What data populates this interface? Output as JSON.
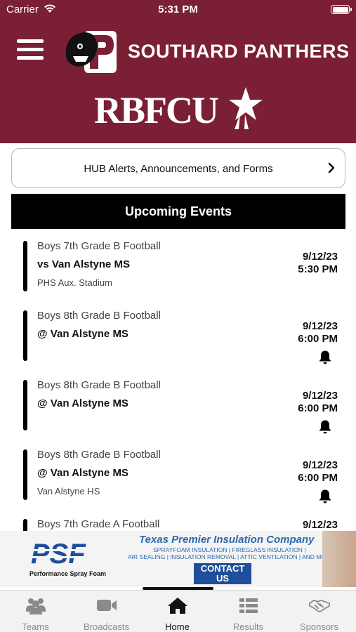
{
  "status_bar": {
    "carrier": "Carrier",
    "time": "5:31 PM"
  },
  "header": {
    "school_name": "SOUTHARD PANTHERS",
    "logo_letter": "P",
    "sponsor": "RBFCU",
    "bg_color": "#7a1f34"
  },
  "alerts": {
    "label": "HUB Alerts, Announcements, and Forms"
  },
  "events": {
    "header": "Upcoming Events",
    "items": [
      {
        "sport": "Boys 7th Grade B Football",
        "opponent": "vs Van Alstyne MS",
        "venue": "PHS Aux. Stadium",
        "date": "9/12/23",
        "time": "5:30 PM",
        "bell": false
      },
      {
        "sport": "Boys 8th Grade B Football",
        "opponent": "@ Van Alstyne MS",
        "venue": "",
        "date": "9/12/23",
        "time": "6:00 PM",
        "bell": true
      },
      {
        "sport": "Boys 8th Grade B Football",
        "opponent": "@ Van Alstyne MS",
        "venue": "",
        "date": "9/12/23",
        "time": "6:00 PM",
        "bell": true
      },
      {
        "sport": "Boys 8th Grade B Football",
        "opponent": "@ Van Alstyne MS",
        "venue": "Van Alstyne HS",
        "date": "9/12/23",
        "time": "6:00 PM",
        "bell": true
      },
      {
        "sport": "Boys 7th Grade A Football",
        "opponent": "",
        "venue": "",
        "date": "9/12/23",
        "time": "",
        "bell": false
      }
    ]
  },
  "ad": {
    "logo_text": "PSF",
    "logo_sub": "Performance Spray Foam",
    "company": "Texas Premier Insulation Company",
    "services_line1": "SPRAYFOAM INSULATION | FIREGLASS INSULATION |",
    "services_line2": "AIR SEALING | INSULATION REMOVAL | ATTIC VENTILATION | AND MORE",
    "cta": "CONTACT US"
  },
  "tabs": [
    {
      "label": "Teams",
      "icon": "teams-icon",
      "active": false
    },
    {
      "label": "Broadcasts",
      "icon": "video-camera-icon",
      "active": false
    },
    {
      "label": "Home",
      "icon": "home-icon",
      "active": true
    },
    {
      "label": "Results",
      "icon": "list-icon",
      "active": false
    },
    {
      "label": "Sponsors",
      "icon": "handshake-icon",
      "active": false
    }
  ]
}
